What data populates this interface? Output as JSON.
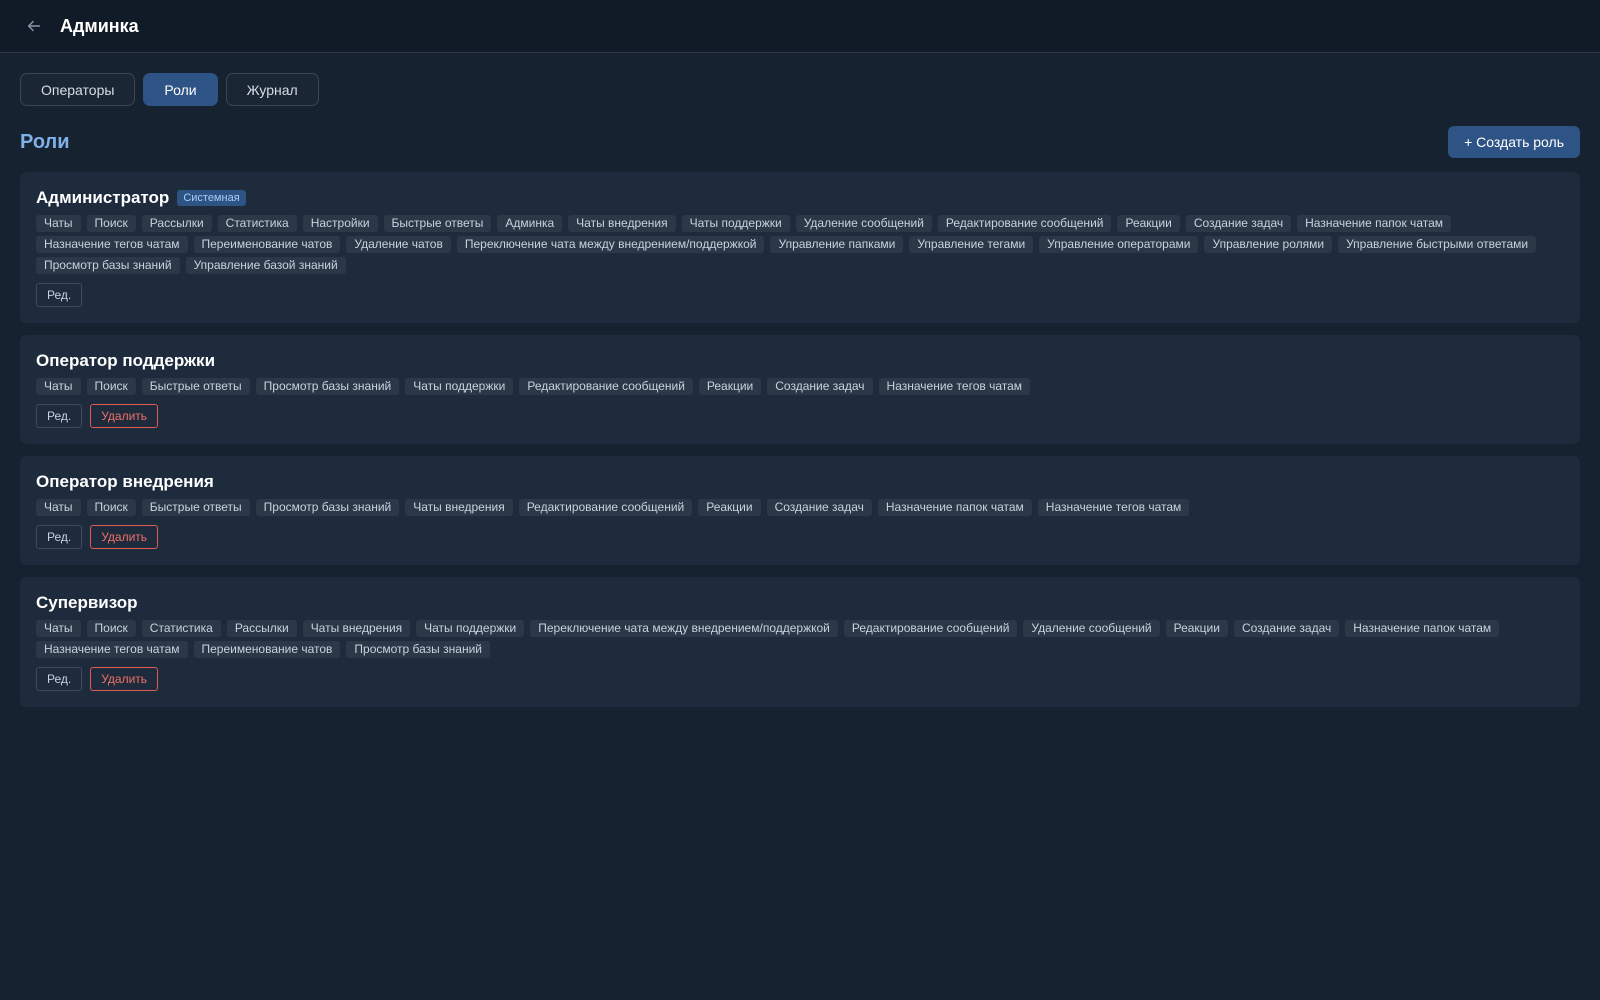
{
  "header": {
    "title": "Админка"
  },
  "tabs": [
    {
      "label": "Операторы",
      "active": false
    },
    {
      "label": "Роли",
      "active": true
    },
    {
      "label": "Журнал",
      "active": false
    }
  ],
  "section": {
    "title": "Роли",
    "create_label": "+ Создать роль"
  },
  "buttons": {
    "edit_label": "Ред.",
    "delete_label": "Удалить"
  },
  "roles": [
    {
      "name": "Администратор",
      "badge": "Системная",
      "deletable": false,
      "permissions": [
        "Чаты",
        "Поиск",
        "Рассылки",
        "Статистика",
        "Настройки",
        "Быстрые ответы",
        "Админка",
        "Чаты внедрения",
        "Чаты поддержки",
        "Удаление сообщений",
        "Редактирование сообщений",
        "Реакции",
        "Создание задач",
        "Назначение папок чатам",
        "Назначение тегов чатам",
        "Переименование чатов",
        "Удаление чатов",
        "Переключение чата между внедрением/поддержкой",
        "Управление папками",
        "Управление тегами",
        "Управление операторами",
        "Управление ролями",
        "Управление быстрыми ответами",
        "Просмотр базы знаний",
        "Управление базой знаний"
      ]
    },
    {
      "name": "Оператор поддержки",
      "deletable": true,
      "permissions": [
        "Чаты",
        "Поиск",
        "Быстрые ответы",
        "Просмотр базы знаний",
        "Чаты поддержки",
        "Редактирование сообщений",
        "Реакции",
        "Создание задач",
        "Назначение тегов чатам"
      ]
    },
    {
      "name": "Оператор внедрения",
      "deletable": true,
      "permissions": [
        "Чаты",
        "Поиск",
        "Быстрые ответы",
        "Просмотр базы знаний",
        "Чаты внедрения",
        "Редактирование сообщений",
        "Реакции",
        "Создание задач",
        "Назначение папок чатам",
        "Назначение тегов чатам"
      ]
    },
    {
      "name": "Супервизор",
      "deletable": true,
      "permissions": [
        "Чаты",
        "Поиск",
        "Статистика",
        "Рассылки",
        "Чаты внедрения",
        "Чаты поддержки",
        "Переключение чата между внедрением/поддержкой",
        "Редактирование сообщений",
        "Удаление сообщений",
        "Реакции",
        "Создание задач",
        "Назначение папок чатам",
        "Назначение тегов чатам",
        "Переименование чатов",
        "Просмотр базы знаний"
      ]
    }
  ]
}
